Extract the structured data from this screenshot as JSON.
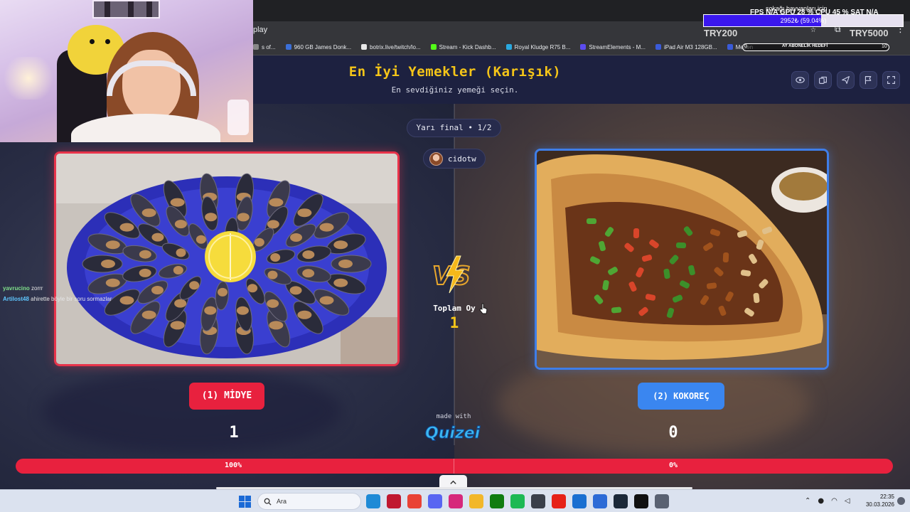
{
  "browser": {
    "address_fragment": "play",
    "bookmarks": [
      {
        "label": "s of...",
        "color": "#888888"
      },
      {
        "label": "960 GB James Donk...",
        "color": "#3b6fd8"
      },
      {
        "label": "botrix.live/twitch/lo...",
        "color": "#e8e8e8"
      },
      {
        "label": "Stream - Kick Dashb...",
        "color": "#53fc18"
      },
      {
        "label": "Royal Kludge R75 B...",
        "color": "#29a9e0"
      },
      {
        "label": "StreamElements - M...",
        "color": "#5b4cf0"
      },
      {
        "label": "iPad Air M3 128GB...",
        "color": "#3a5bd9"
      },
      {
        "label": "Meden",
        "color": "#3a5bd9"
      }
    ]
  },
  "overlay": {
    "perf_stats": "FPS N/A   GPU 28 %   CPU 45 %   SAT N/A",
    "donate_note": "sokağı hayvanları için",
    "goal_text": "2952₺ (59.04%)",
    "goal_progress": 0.5904,
    "goal_start": "TRY200",
    "goal_end": "TRY5000",
    "sub_goal_label": "AY ABONELİK HEDEFİ",
    "sub_goal_start": "0",
    "sub_goal_end": "10",
    "chat": [
      {
        "user": "yavrucino",
        "message": "zorrr"
      },
      {
        "user": "Artilost48",
        "message": "ahirette böyle bir soru sormazlar"
      }
    ]
  },
  "quiz": {
    "title": "En İyi Yemekler (Karışık)",
    "subtitle": "En sevdiğiniz yemeği seçin.",
    "round": "Yarı final • 1/2",
    "user": "cidotw",
    "vote_label": "Toplam Oy",
    "vote_total": "1",
    "vs_text": "VS",
    "left": {
      "label": "(1) MİDYE",
      "score": "1",
      "percent": "100%",
      "color": "#e8213e"
    },
    "right": {
      "label": "(2) KOKOREÇ",
      "score": "0",
      "percent": "0%",
      "color": "#3a86f0"
    },
    "made_with": "made with",
    "brand": "Quizei",
    "left_share": 1.0
  },
  "taskbar": {
    "search_placeholder": "Ara",
    "time": "22:35",
    "date": "30.03.2026",
    "apps": [
      "edge-icon",
      "red-app-icon",
      "chrome-icon",
      "discord-icon",
      "instagram-icon",
      "folder-icon",
      "xbox-icon",
      "spotify-icon",
      "clock-app-icon",
      "youtube-icon",
      "mail-icon",
      "notes-icon",
      "steam-icon",
      "tiktok-icon",
      "settings-icon"
    ]
  }
}
